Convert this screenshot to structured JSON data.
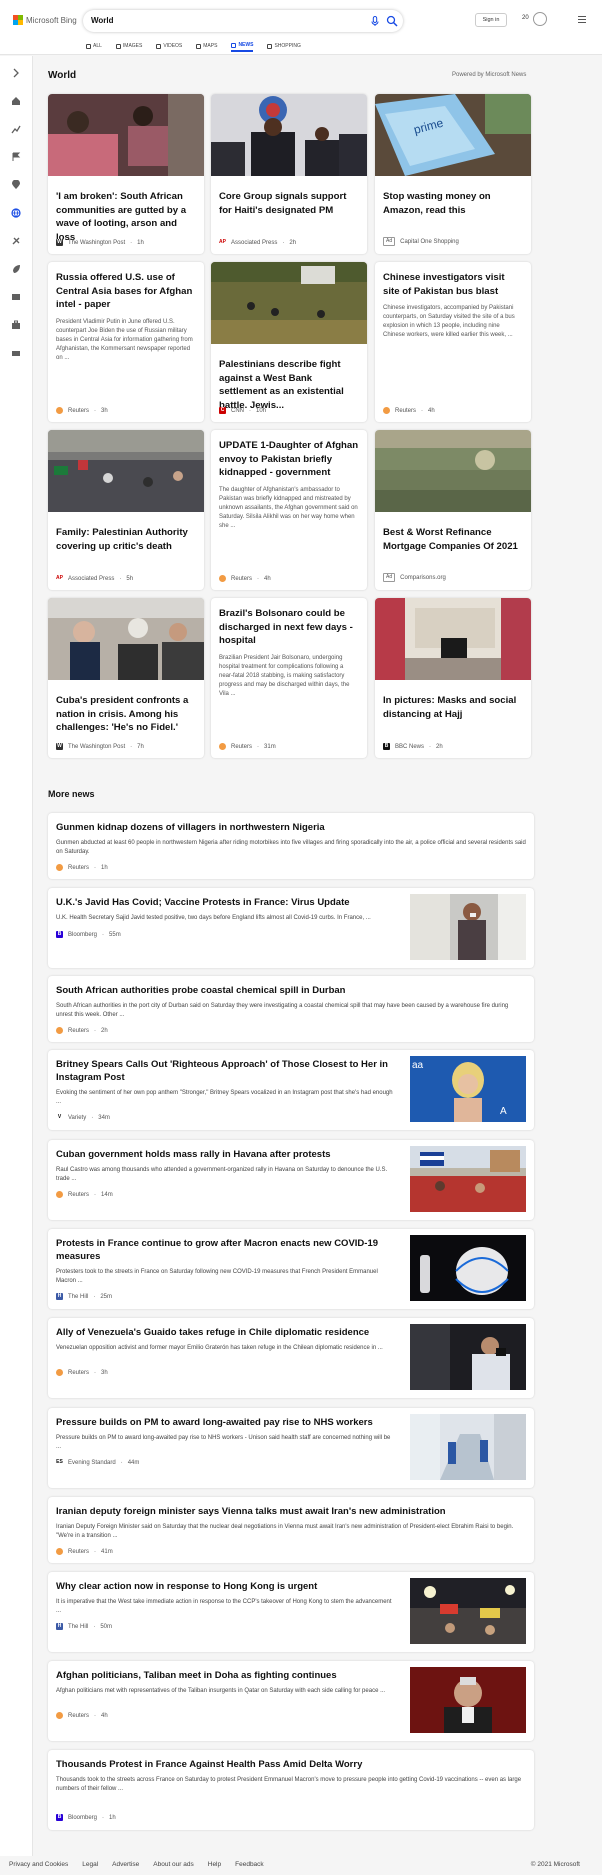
{
  "brand": {
    "name": "Microsoft Bing"
  },
  "search": {
    "query": "World"
  },
  "header": {
    "signin": "Sign in",
    "points": "20"
  },
  "tabs": [
    {
      "label": "ALL"
    },
    {
      "label": "IMAGES"
    },
    {
      "label": "VIDEOS"
    },
    {
      "label": "MAPS"
    },
    {
      "label": "NEWS"
    },
    {
      "label": "SHOPPING"
    }
  ],
  "section": {
    "title": "World",
    "powered": "Powered by Microsoft News",
    "more": "More news"
  },
  "cards": [
    {
      "title": "'I am broken': South African communities are gutted by a wave of looting, arson and loss",
      "source": "The Washington Post",
      "time": "1h"
    },
    {
      "title": "Core Group signals support for Haiti's designated PM",
      "source": "Associated Press",
      "time": "2h"
    },
    {
      "title": "Stop wasting money on Amazon, read this",
      "ad": "Ad",
      "source": "Capital One Shopping"
    },
    {
      "title": "Russia offered U.S. use of Central Asia bases for Afghan intel - paper",
      "snippet": "President Vladimir Putin in June offered U.S. counterpart Joe Biden the use of Russian military bases in Central Asia for information gathering from Afghanistan, the Kommersant newspaper reported on ...",
      "source": "Reuters",
      "time": "3h"
    },
    {
      "title": "Palestinians describe fight against a West Bank settlement as an existential battle. Jewis...",
      "source": "CNN",
      "time": "10h"
    },
    {
      "title": "Chinese investigators visit site of Pakistan bus blast",
      "snippet": "Chinese investigators, accompanied by Pakistani counterparts, on Saturday visited the site of a bus explosion in which 13 people, including nine Chinese workers, were killed earlier this week, ...",
      "source": "Reuters",
      "time": "4h"
    },
    {
      "title": "Family: Palestinian Authority covering up critic's death",
      "source": "Associated Press",
      "time": "5h"
    },
    {
      "title": "UPDATE 1-Daughter of Afghan envoy to Pakistan briefly kidnapped - government",
      "snippet": "The daughter of Afghanistan's ambassador to Pakistan was briefly kidnapped and mistreated by unknown assailants, the Afghan government said on Saturday. Silsila Alikhil was on her way home when she ...",
      "source": "Reuters",
      "time": "4h"
    },
    {
      "title": "Best & Worst Refinance Mortgage Companies Of 2021",
      "ad": "Ad",
      "source": "Comparisons.org"
    },
    {
      "title": "Cuba's president confronts a nation in crisis. Among his challenges: 'He's no Fidel.'",
      "source": "The Washington Post",
      "time": "7h"
    },
    {
      "title": "Brazil's Bolsonaro could be discharged in next few days - hospital",
      "snippet": "Brazilian President Jair Bolsonaro, undergoing hospital treatment for complications following a near-fatal 2018 stabbing, is making satisfactory progress and may be discharged within days, the Vila ...",
      "source": "Reuters",
      "time": "31m"
    },
    {
      "title": "In pictures: Masks and social distancing at Hajj",
      "source": "BBC News",
      "time": "2h"
    }
  ],
  "news": [
    {
      "title": "Gunmen kidnap dozens of villagers in northwestern Nigeria",
      "snippet": "Gunmen abducted at least 60 people in northwestern Nigeria after riding motorbikes into five villages and firing sporadically into the air, a police official and several residents said on Saturday.",
      "source": "Reuters",
      "time": "1h"
    },
    {
      "title": "U.K.'s Javid Has Covid; Vaccine Protests in France: Virus Update",
      "snippet": "U.K. Health Secretary Sajid Javid tested positive, two days before England lifts almost all Covid-19 curbs. In France, ...",
      "source": "Bloomberg",
      "time": "55m"
    },
    {
      "title": "South African authorities probe coastal chemical spill in Durban",
      "snippet": "South African authorities in the port city of Durban said on Saturday they were investigating a coastal chemical spill that may have been caused by a warehouse fire during unrest this week. Other ...",
      "source": "Reuters",
      "time": "2h"
    },
    {
      "title": "Britney Spears Calls Out 'Righteous Approach' of Those Closest to Her in Instagram Post",
      "snippet": "Evoking the sentiment of her own pop anthem \"Stronger,\" Britney Spears vocalized in an Instagram post that she's had enough ...",
      "source": "Variety",
      "time": "34m"
    },
    {
      "title": "Cuban government holds mass rally in Havana after protests",
      "snippet": "Raul Castro was among thousands who attended a government-organized rally in Havana on Saturday to denounce the U.S. trade ...",
      "source": "Reuters",
      "time": "14m"
    },
    {
      "title": "Protests in France continue to grow after Macron enacts new COVID-19 measures",
      "snippet": "Protesters took to the streets in France on Saturday following new COVID-19 measures that French President Emmanuel Macron ...",
      "source": "The Hill",
      "time": "25m"
    },
    {
      "title": "Ally of Venezuela's Guaido takes refuge in Chile diplomatic residence",
      "snippet": "Venezuelan opposition activist and former mayor Emilio Graterón has taken refuge in the Chilean diplomatic residence in ...",
      "source": "Reuters",
      "time": "3h"
    },
    {
      "title": "Pressure builds on PM to award long-awaited pay rise to NHS workers",
      "snippet": "Pressure builds on PM to award long-awaited pay rise to NHS workers - Unison said health staff are concerned nothing will be ...",
      "source": "Evening Standard",
      "time": "44m"
    },
    {
      "title": "Iranian deputy foreign minister says Vienna talks must await Iran's new administration",
      "snippet": "Iranian Deputy Foreign Minister said on Saturday that the nuclear deal negotiations in Vienna must await Iran's new administration of President-elect Ebrahim Raisi to begin. \"We're in a transition ...",
      "source": "Reuters",
      "time": "41m"
    },
    {
      "title": "Why clear action now in response to Hong Kong is urgent",
      "snippet": "It is imperative that the West take immediate action in response to the CCP's takeover of Hong Kong to stem the advancement ...",
      "source": "The Hill",
      "time": "50m"
    },
    {
      "title": "Afghan politicians, Taliban meet in Doha as fighting continues",
      "snippet": "Afghan politicians met with representatives of the Taliban insurgents in Qatar on Saturday with each side calling for peace ...",
      "source": "Reuters",
      "time": "4h"
    },
    {
      "title": "Thousands Protest in France Against Health Pass Amid Delta Worry",
      "snippet": "Thousands took to the streets across France on Saturday to protest President Emmanuel Macron's move to pressure people into getting Covid-19 vaccinations -- even as large numbers of their fellow ...",
      "source": "Bloomberg",
      "time": "1h"
    }
  ],
  "footer": {
    "links": [
      "Privacy and Cookies",
      "Legal",
      "Advertise",
      "About our ads",
      "Help",
      "Feedback"
    ],
    "copyright": "© 2021 Microsoft"
  }
}
